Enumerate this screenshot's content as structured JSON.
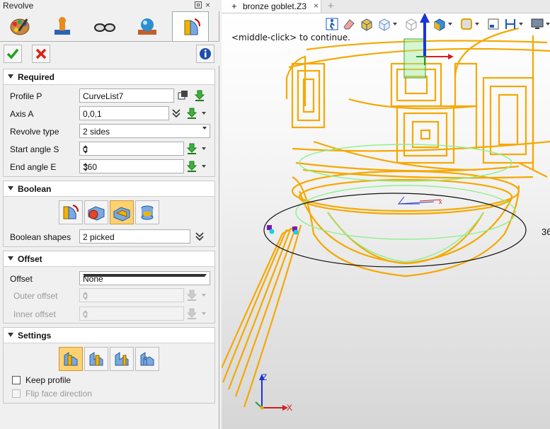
{
  "panel": {
    "title": "Revolve",
    "close": "×",
    "tabs": [
      {
        "icon": "paint-palette-icon"
      },
      {
        "icon": "stamp-icon"
      },
      {
        "icon": "glasses-icon"
      },
      {
        "icon": "render-sphere-icon"
      },
      {
        "icon": "revolve-feature-icon"
      }
    ],
    "sections": {
      "required": {
        "title": "Required",
        "profile_label": "Profile P",
        "profile_value": "CurveList7",
        "axis_label": "Axis A",
        "axis_value": "0,0,1",
        "type_label": "Revolve type",
        "type_value": "2 sides",
        "start_label": "Start angle S",
        "start_value": "0",
        "end_label": "End angle E",
        "end_value": "360"
      },
      "boolean": {
        "title": "Boolean",
        "shapes_label": "Boolean shapes",
        "shapes_value": "2 picked"
      },
      "offset": {
        "title": "Offset",
        "offset_label": "Offset",
        "offset_value": "None",
        "outer_label": "Outer offset",
        "outer_value": "0",
        "inner_label": "Inner offset",
        "inner_value": "0"
      },
      "settings": {
        "title": "Settings",
        "keep_profile": "Keep profile",
        "flip_face": "Flip face direction"
      }
    }
  },
  "viewport": {
    "tab_plus": "+",
    "tab_name": "bronze goblet.Z3",
    "tab_close": "×",
    "new_tab": "+",
    "hint": "<middle-click> to continue.",
    "dim_label": "36",
    "axis_x": "X",
    "axis_z": "Z",
    "wire_color": "#f5a800",
    "guide_color": "#8ef08e"
  }
}
